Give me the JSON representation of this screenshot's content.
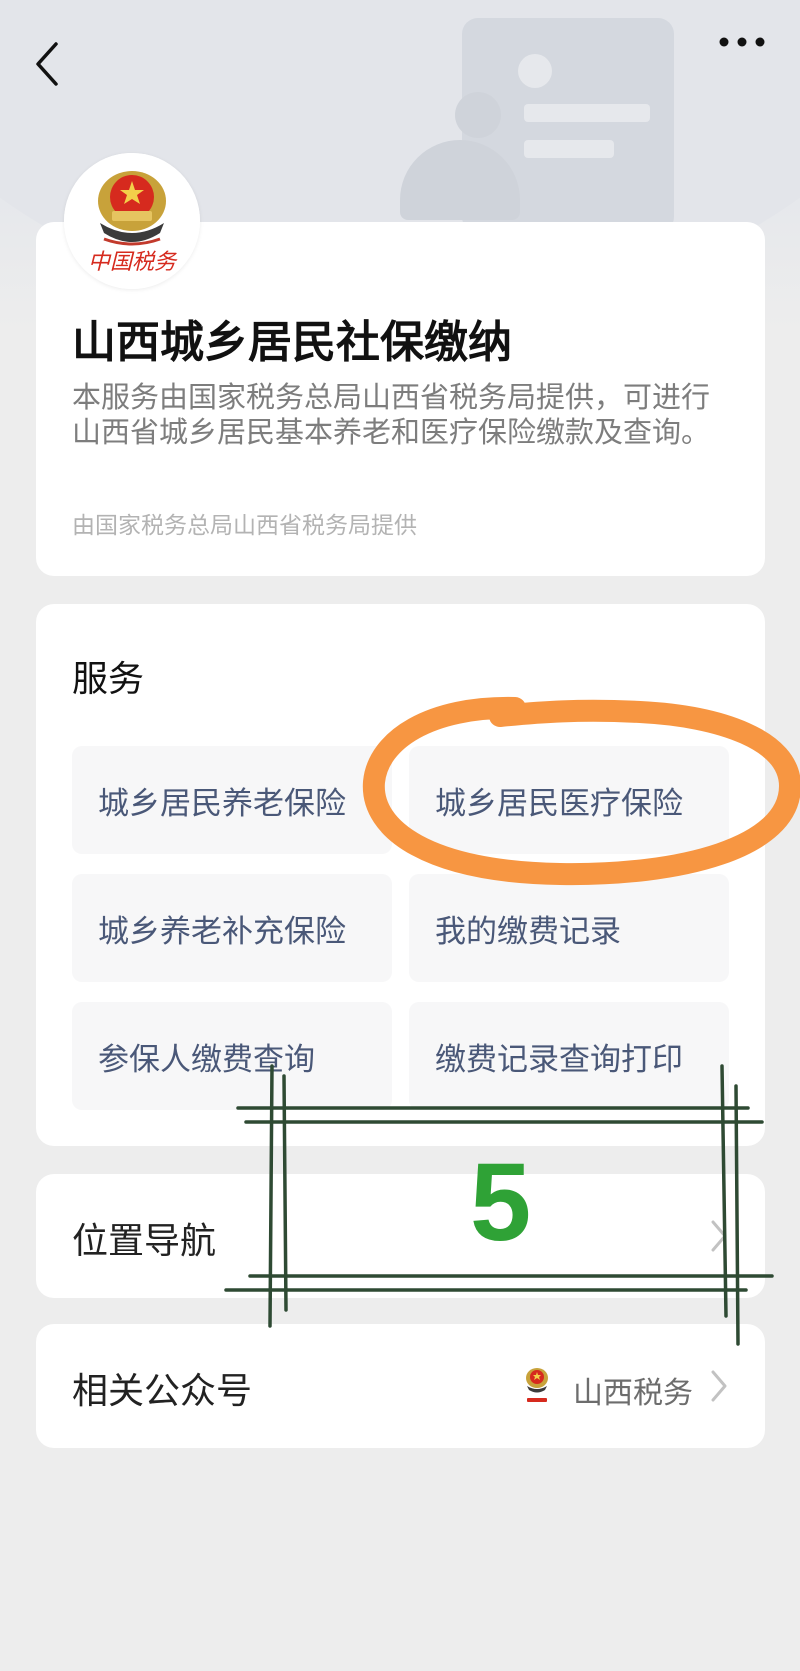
{
  "app": {
    "title": "山西城乡居民社保缴纳",
    "description": "本服务由国家税务总局山西省税务局提供，可进行山西省城乡居民基本养老和医疗保险缴款及查询。",
    "provider": "由国家税务总局山西省税务局提供",
    "logo_text": "中国税务"
  },
  "services": {
    "title": "服务",
    "items": [
      {
        "label": "城乡居民养老保险"
      },
      {
        "label": "城乡居民医疗保险"
      },
      {
        "label": "城乡养老补充保险"
      },
      {
        "label": "我的缴费记录"
      },
      {
        "label": "参保人缴费查询"
      },
      {
        "label": "缴费记录查询打印"
      }
    ]
  },
  "navigation": {
    "label": "位置导航"
  },
  "official_account": {
    "label": "相关公众号",
    "name": "山西税务"
  },
  "annotations": {
    "number": "5",
    "circle_color": "#f7923a",
    "box_color": "#2e4a33",
    "number_color": "#2fa236"
  }
}
